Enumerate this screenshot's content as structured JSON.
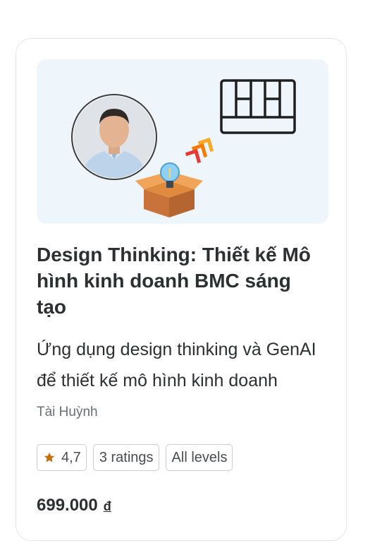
{
  "course": {
    "title": "Design Thinking: Thiết kế Mô hình kinh doanh BMC sáng tạo",
    "subtitle": "Ứng dụng design thinking và GenAI để thiết kế mô hình kinh doanh",
    "instructor": "Tài Huỳnh",
    "rating": "4,7",
    "ratings_count": "3 ratings",
    "level": "All levels",
    "price": "699.000",
    "currency": "đ"
  },
  "icons": {
    "rating_star": "star-icon",
    "thumbnail": [
      "instructor-avatar",
      "lightbulb-icon",
      "box-icon",
      "arrows-icon",
      "canvas-grid-icon"
    ]
  },
  "colors": {
    "star": "#c4710d",
    "thumbnail_bg": "#eef6fc",
    "text": "#2d2f31",
    "muted": "#6a6f73"
  }
}
